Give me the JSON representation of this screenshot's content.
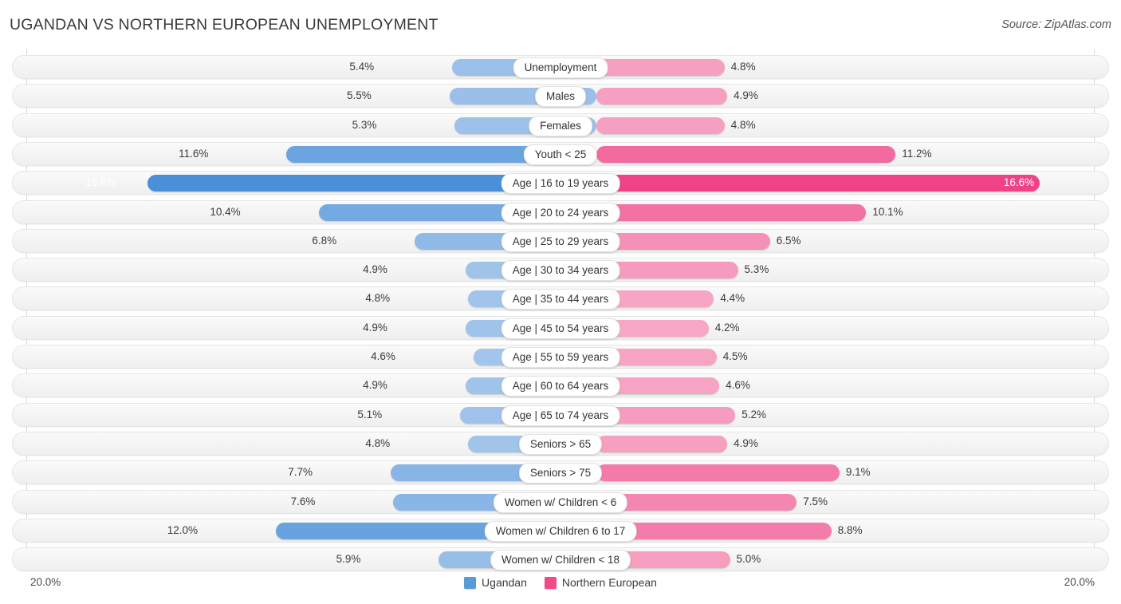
{
  "header": {
    "title": "UGANDAN VS NORTHERN EUROPEAN UNEMPLOYMENT",
    "source": "Source: ZipAtlas.com"
  },
  "axis": {
    "left_tick": "20.0%",
    "right_tick": "20.0%",
    "max": 20.0
  },
  "legend": {
    "items": [
      {
        "label": "Ugandan",
        "color": "#5b9bd5"
      },
      {
        "label": "Northern European",
        "color": "#f04b89"
      }
    ]
  },
  "colors": {
    "left_light": "#a8c8ec",
    "left_dark": "#4a90d9",
    "right_light": "#f7a8c6",
    "right_dark": "#ef4186",
    "track": "#f3f3f3",
    "text": "#3b3b3b"
  },
  "chart_data": {
    "type": "bar",
    "orientation": "horizontal-diverging",
    "title": "UGANDAN VS NORTHERN EUROPEAN UNEMPLOYMENT",
    "xlabel": "",
    "ylabel": "",
    "xlim": [
      20.0,
      20.0
    ],
    "grid": false,
    "legend_position": "bottom-center",
    "unit": "%",
    "categories": [
      "Unemployment",
      "Males",
      "Females",
      "Youth < 25",
      "Age | 16 to 19 years",
      "Age | 20 to 24 years",
      "Age | 25 to 29 years",
      "Age | 30 to 34 years",
      "Age | 35 to 44 years",
      "Age | 45 to 54 years",
      "Age | 55 to 59 years",
      "Age | 60 to 64 years",
      "Age | 65 to 74 years",
      "Seniors > 65",
      "Seniors > 75",
      "Women w/ Children < 6",
      "Women w/ Children 6 to 17",
      "Women w/ Children < 18"
    ],
    "series": [
      {
        "name": "Ugandan",
        "side": "left",
        "values": [
          5.4,
          5.5,
          5.3,
          11.6,
          16.8,
          10.4,
          6.8,
          4.9,
          4.8,
          4.9,
          4.6,
          4.9,
          5.1,
          4.8,
          7.7,
          7.6,
          12.0,
          5.9
        ],
        "labels": [
          "5.4%",
          "5.5%",
          "5.3%",
          "11.6%",
          "16.8%",
          "10.4%",
          "6.8%",
          "4.9%",
          "4.8%",
          "4.9%",
          "4.6%",
          "4.9%",
          "5.1%",
          "4.8%",
          "7.7%",
          "7.6%",
          "12.0%",
          "5.9%"
        ]
      },
      {
        "name": "Northern European",
        "side": "right",
        "values": [
          4.8,
          4.9,
          4.8,
          11.2,
          16.6,
          10.1,
          6.5,
          5.3,
          4.4,
          4.2,
          4.5,
          4.6,
          5.2,
          4.9,
          9.1,
          7.5,
          8.8,
          5.0
        ],
        "labels": [
          "4.8%",
          "4.9%",
          "4.8%",
          "11.2%",
          "16.6%",
          "10.1%",
          "6.5%",
          "5.3%",
          "4.4%",
          "4.2%",
          "4.5%",
          "4.6%",
          "5.2%",
          "4.9%",
          "9.1%",
          "7.5%",
          "8.8%",
          "5.0%"
        ]
      }
    ]
  }
}
